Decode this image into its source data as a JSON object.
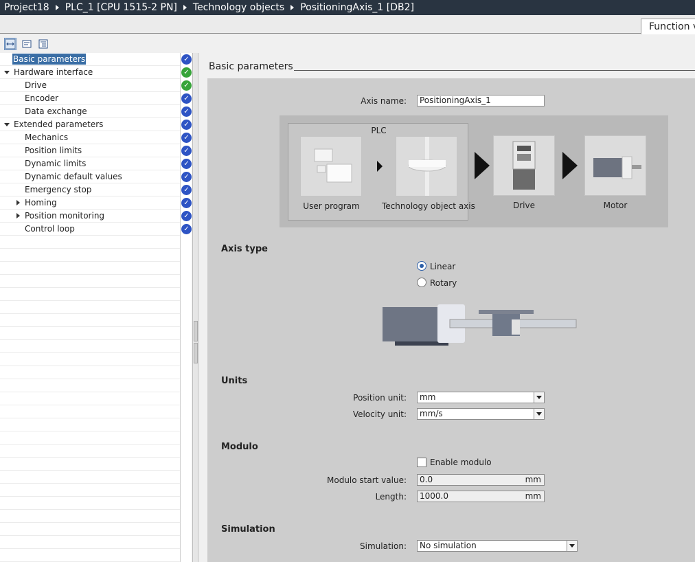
{
  "breadcrumb": {
    "items": [
      "Project18",
      "PLC_1 [CPU 1515-2 PN]",
      "Technology objects",
      "PositioningAxis_1 [DB2]"
    ]
  },
  "tabs": {
    "function_view": "Function v"
  },
  "nav": {
    "items": [
      {
        "label": "Basic parameters",
        "status": "blue"
      },
      {
        "label": "Hardware interface",
        "status": "green"
      },
      {
        "label": "Drive",
        "status": "green"
      },
      {
        "label": "Encoder",
        "status": "blue"
      },
      {
        "label": "Data exchange",
        "status": "blue"
      },
      {
        "label": "Extended parameters",
        "status": "blue"
      },
      {
        "label": "Mechanics",
        "status": "blue"
      },
      {
        "label": "Position limits",
        "status": "blue"
      },
      {
        "label": "Dynamic limits",
        "status": "blue"
      },
      {
        "label": "Dynamic default values",
        "status": "blue"
      },
      {
        "label": "Emergency stop",
        "status": "blue"
      },
      {
        "label": "Homing",
        "status": "blue"
      },
      {
        "label": "Position monitoring",
        "status": "blue"
      },
      {
        "label": "Control loop",
        "status": "blue"
      }
    ]
  },
  "content": {
    "section_title": "Basic parameters",
    "axis_name": {
      "label": "Axis name:",
      "value": "PositioningAxis_1"
    },
    "diagram": {
      "plc_label": "PLC",
      "user_program": "User program",
      "tech_object": "Technology object axis",
      "drive": "Drive",
      "motor": "Motor"
    },
    "axis_type": {
      "title": "Axis type",
      "linear": "Linear",
      "rotary": "Rotary",
      "selected": "Linear"
    },
    "units": {
      "title": "Units",
      "position_label": "Position unit:",
      "position_value": "mm",
      "velocity_label": "Velocity unit:",
      "velocity_value": "mm/s"
    },
    "modulo": {
      "title": "Modulo",
      "enable_label": "Enable modulo",
      "enabled": false,
      "start_label": "Modulo start value:",
      "start_value": "0.0",
      "start_unit": "mm",
      "length_label": "Length:",
      "length_value": "1000.0",
      "length_unit": "mm"
    },
    "simulation": {
      "title": "Simulation",
      "label": "Simulation:",
      "value": "No simulation"
    }
  },
  "colors": {
    "titlebar": "#293441",
    "status_blue": "#2e54c4",
    "status_green": "#37a43a",
    "selection": "#3a6ea5"
  }
}
